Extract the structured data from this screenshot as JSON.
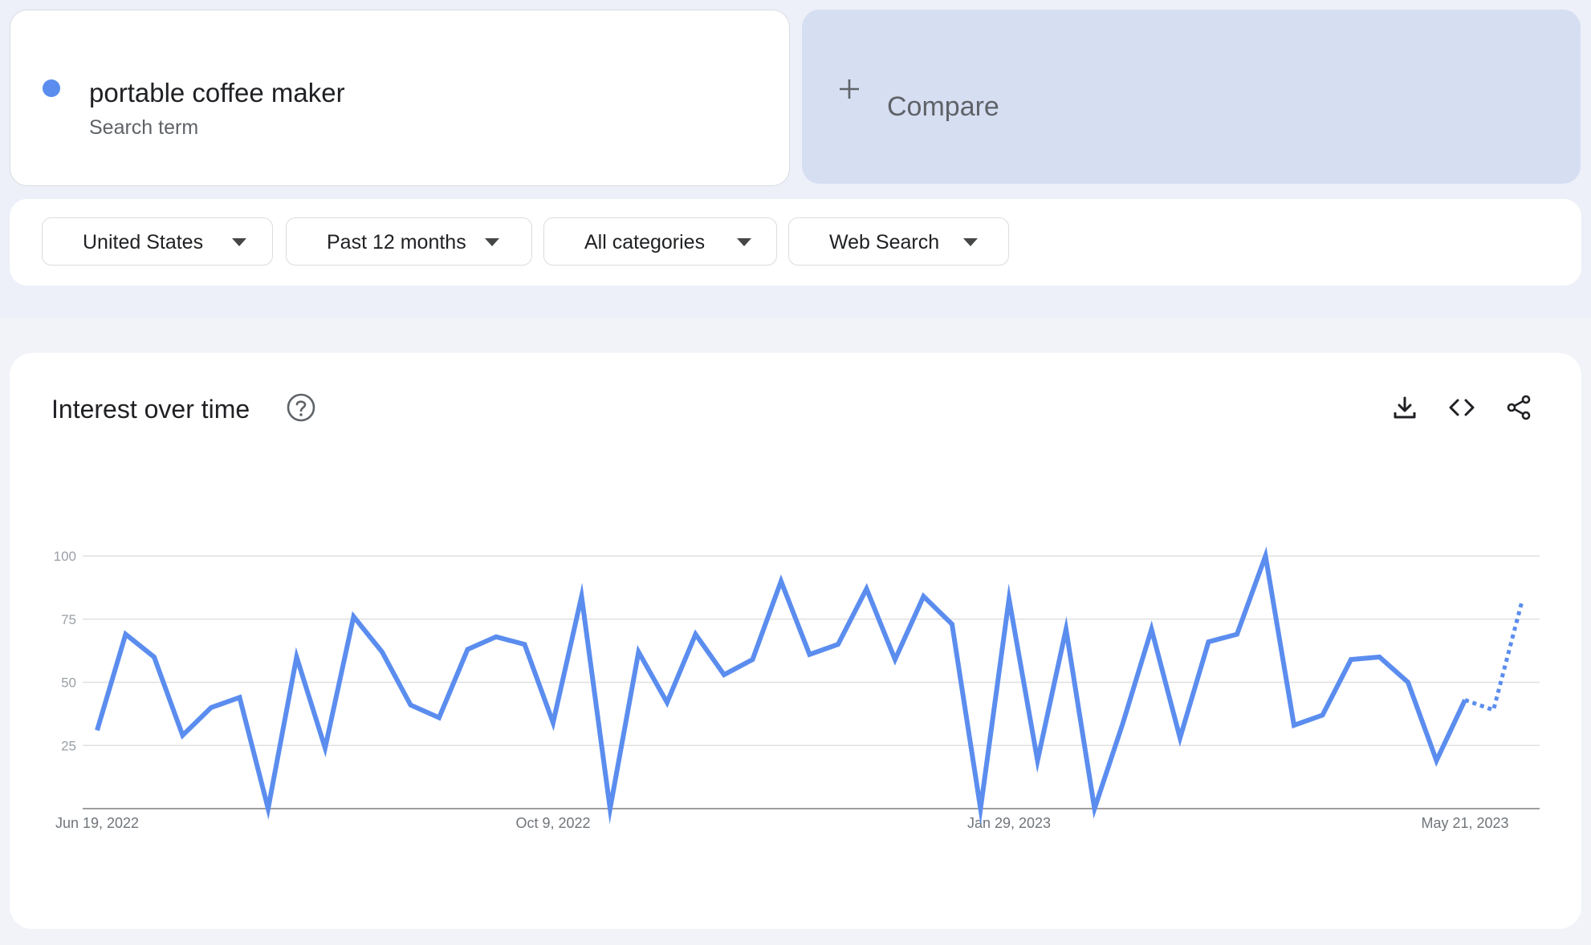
{
  "search": {
    "term": "portable coffee maker",
    "term_type": "Search term",
    "term_color": "#5b8def",
    "compare_label": "Compare"
  },
  "filters": [
    {
      "label": "United States"
    },
    {
      "label": "Past 12 months"
    },
    {
      "label": "All categories"
    },
    {
      "label": "Web Search"
    }
  ],
  "panel": {
    "title": "Interest over time",
    "help_icon": "help-circle-icon",
    "tool_icons": [
      "download-icon",
      "embed-code-icon",
      "share-icon"
    ]
  },
  "chart_data": {
    "type": "line",
    "title": "Interest over time",
    "ylim": [
      0,
      100
    ],
    "y_ticks": [
      "25",
      "50",
      "75",
      "100"
    ],
    "x_tick_labels": [
      {
        "label": "Jun 19, 2022",
        "index": 0
      },
      {
        "label": "Oct 9, 2022",
        "index": 16
      },
      {
        "label": "Jan 29, 2023",
        "index": 32
      },
      {
        "label": "May 21, 2023",
        "index": 48
      }
    ],
    "grid": true,
    "line_color": "#5b8def",
    "partial_data_from_index": 49,
    "series": [
      {
        "values": [
          31,
          69,
          60,
          29,
          40,
          44,
          0,
          60,
          24,
          76,
          62,
          41,
          36,
          63,
          68,
          65,
          34,
          84,
          0,
          62,
          42,
          69,
          53,
          59,
          90,
          61,
          65,
          87,
          59,
          84,
          73,
          0,
          83,
          19,
          71,
          0,
          34,
          71,
          28,
          66,
          69,
          100,
          33,
          37,
          59,
          60,
          50,
          19,
          43,
          39,
          82
        ]
      }
    ]
  }
}
